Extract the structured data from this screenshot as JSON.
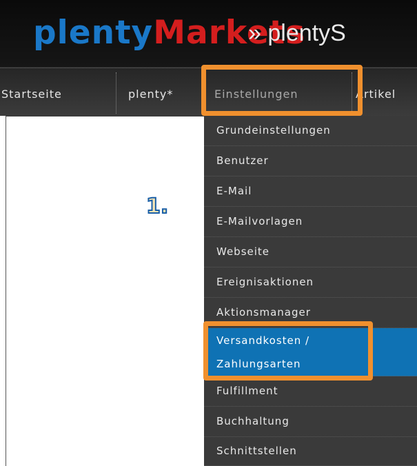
{
  "header": {
    "logo_part1": "plenty",
    "logo_part2": "Markets",
    "breadcrumb": "» plentyS"
  },
  "nav": {
    "items": [
      {
        "label": "Startseite"
      },
      {
        "label": "plenty*"
      },
      {
        "label": "Einstellungen"
      },
      {
        "label": "Artikel"
      }
    ]
  },
  "annotation": {
    "step_label": "1."
  },
  "dropdown": {
    "items": [
      {
        "label": "Grundeinstellungen"
      },
      {
        "label": "Benutzer"
      },
      {
        "label": "E-Mail"
      },
      {
        "label": "E-Mailvorlagen"
      },
      {
        "label": "Webseite"
      },
      {
        "label": "Ereignisaktionen"
      },
      {
        "label": "Aktionsmanager"
      },
      {
        "label": "Versandkosten /",
        "label2": "Zahlungsarten",
        "selected": true
      },
      {
        "label": "Fulfillment"
      },
      {
        "label": "Buchhaltung"
      },
      {
        "label": "Schnittstellen"
      }
    ]
  },
  "colors": {
    "highlight": "#f0902e",
    "selected_bg": "#0f72b4",
    "logo_blue": "#1a78c8",
    "logo_red": "#d41e1e"
  }
}
